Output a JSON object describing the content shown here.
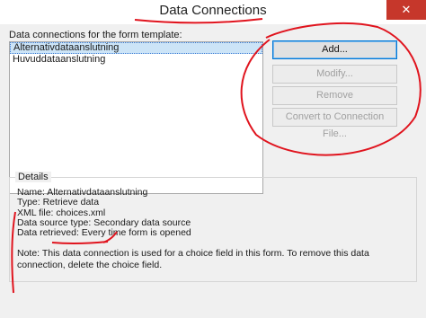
{
  "window": {
    "title": "Data Connections",
    "close_glyph": "✕"
  },
  "list": {
    "label": "Data connections for the form template:",
    "items": [
      "Alternativdataanslutning",
      "Huvuddataanslutning"
    ],
    "selected_index": 0
  },
  "buttons": {
    "add": "Add...",
    "modify": "Modify...",
    "remove": "Remove",
    "convert": "Convert to Connection File..."
  },
  "details": {
    "legend": "Details",
    "lines": [
      "Name: Alternativdataanslutning",
      "Type: Retrieve data",
      "XML file: choices.xml",
      "Data source type: Secondary data source",
      "Data retrieved: Every time form is opened"
    ],
    "note": "Note: This data connection is used for a choice field in this form. To remove this data connection, delete the choice field."
  },
  "colors": {
    "annotation": "#e0141e",
    "close_bg": "#c6372b",
    "selection": "#cce4f7"
  }
}
